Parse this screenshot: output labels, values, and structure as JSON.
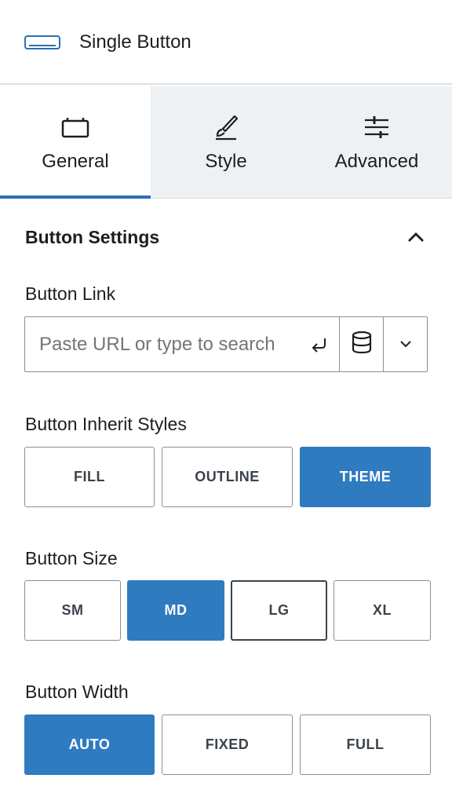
{
  "header": {
    "title": "Single Button",
    "icon": "button-block-icon"
  },
  "tabs": [
    {
      "label": "General",
      "icon": "general-icon",
      "active": true
    },
    {
      "label": "Style",
      "icon": "brush-icon",
      "active": false
    },
    {
      "label": "Advanced",
      "icon": "sliders-icon",
      "active": false
    }
  ],
  "panel": {
    "title": "Button Settings",
    "link": {
      "label": "Button Link",
      "placeholder": "Paste URL or type to search",
      "value": ""
    },
    "inherit": {
      "label": "Button Inherit Styles",
      "options": [
        "FILL",
        "OUTLINE",
        "THEME"
      ],
      "selected": "THEME"
    },
    "size": {
      "label": "Button Size",
      "options": [
        "SM",
        "MD",
        "LG",
        "XL"
      ],
      "selected": "MD"
    },
    "width": {
      "label": "Button Width",
      "options": [
        "AUTO",
        "FIXED",
        "FULL"
      ],
      "selected": "AUTO"
    }
  },
  "colors": {
    "accent": "#2f7bbf",
    "tab_inactive_bg": "#eef1f4",
    "border": "#8c8f94"
  }
}
